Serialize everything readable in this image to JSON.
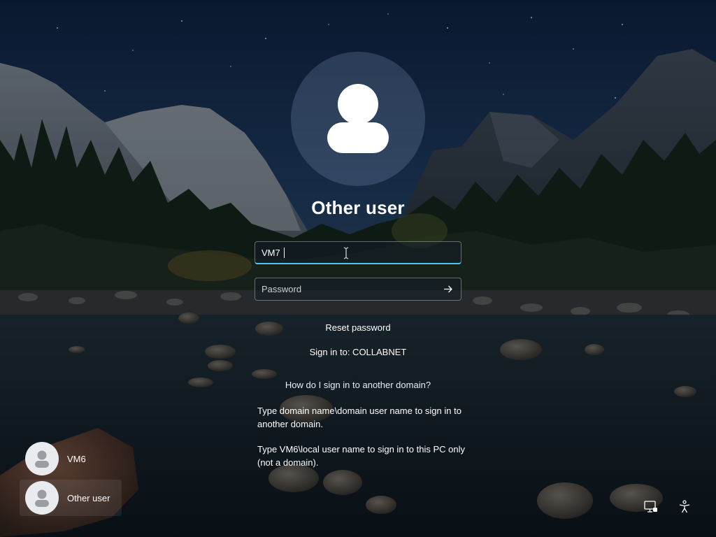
{
  "login": {
    "title": "Other user",
    "username_value": "VM7",
    "password_placeholder": "Password",
    "reset_password": "Reset password",
    "sign_in_to": "Sign in to: COLLABNET",
    "how_domain": "How do I sign in to another domain?",
    "help_domain": "Type domain name\\domain user name to sign in to another domain.",
    "help_local": "Type VM6\\local user name to sign in to this PC only (not a domain)."
  },
  "user_list": [
    {
      "label": "VM6",
      "icon": "user-avatar-icon"
    },
    {
      "label": "Other user",
      "icon": "user-avatar-icon"
    }
  ],
  "corner_icons": {
    "network": "network-icon",
    "accessibility": "accessibility-icon"
  },
  "colors": {
    "accent": "#4cc2ff",
    "text": "#ffffff"
  }
}
